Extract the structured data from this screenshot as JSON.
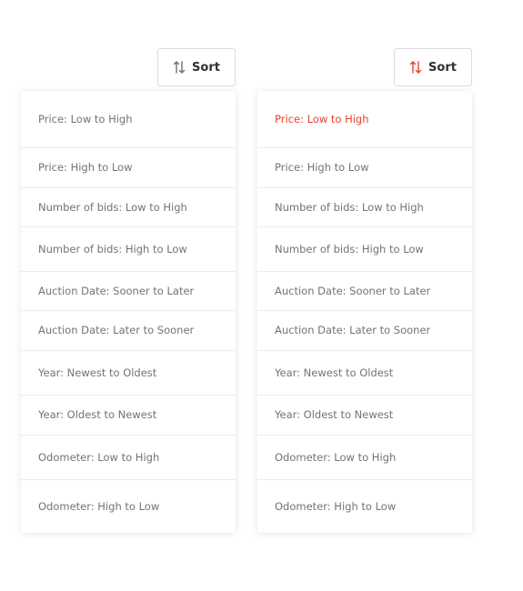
{
  "left": {
    "sort_label": "Sort",
    "icon": "sort-arrows-icon",
    "icon_color": "#6f6f76",
    "selected_index": -1,
    "options": [
      "Price: Low to High",
      "Price: High to Low",
      "Number of bids: Low to High",
      "Number of bids: High to Low",
      "Auction Date: Sooner to Later",
      "Auction Date: Later to Sooner",
      "Year: Newest to Oldest",
      "Year: Oldest to Newest",
      "Odometer: Low to High",
      "Odometer: High to Low"
    ]
  },
  "right": {
    "sort_label": "Sort",
    "icon": "sort-arrows-icon",
    "icon_color": "#e8412b",
    "selected_index": 0,
    "options": [
      "Price: Low to High",
      "Price: High to Low",
      "Number of bids: Low to High",
      "Number of bids: High to Low",
      "Auction Date: Sooner to Later",
      "Auction Date: Later to Sooner",
      "Year: Newest to Oldest",
      "Year: Oldest to Newest",
      "Odometer: Low to High",
      "Odometer: High to Low"
    ]
  },
  "colors": {
    "accent": "#e8412b",
    "text": "#737378",
    "divider": "#ececee"
  }
}
